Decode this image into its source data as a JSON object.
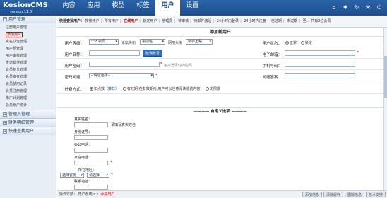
{
  "app": {
    "name": "KesionCMS",
    "version": "version 11.0"
  },
  "mainnav": [
    "内容",
    "应用",
    "模型",
    "标签",
    "用户",
    "设置"
  ],
  "mainnav_active": 4,
  "top_icons": [
    "home-icon",
    "star-icon",
    "refresh-icon",
    "wrench-icon",
    "power-icon"
  ],
  "sidebar": {
    "head": "用户管理",
    "items": [
      "注册用户管理",
      "添加用户",
      "实名认证管理",
      "用户组管理",
      "用户审核管理",
      "发送邮件管理",
      "会员积分管理",
      "会员资金管理",
      "会员使用记录",
      "会员注册管理",
      "推广计划管理",
      "会员账户统计"
    ],
    "active_index": 1,
    "groups": [
      "管理员管理",
      "财务明细管理",
      "快速查找用户"
    ]
  },
  "subnav": {
    "lead": "快速查找用户：",
    "items": [
      "搜索用户",
      "所有用户",
      "在线用户",
      "锁定用户",
      "管理员",
      "待审核",
      "待邮件激活",
      "24小时内登录",
      "24小时内注册",
      "已过期",
      "未过期",
      "更…"
    ],
    "active_index": 2,
    "right": "共有2位会员"
  },
  "form": {
    "title": "添加新用户",
    "group_label": "用户等级：",
    "group_value": "个人会员",
    "title_label": "论坛头衔",
    "title_value": "学前班",
    "level_label": "网吧头衔",
    "level_value": "新手上路",
    "status_label": "用户状态：",
    "status_normal": "正常",
    "status_locked": "锁定",
    "username_label": "用户名称：",
    "check_btn": "检测账号",
    "email_label": "电子邮箱：",
    "password_label": "用户密码：",
    "password_hint": "用户登录时的密码",
    "mobile_label": "手机号码：",
    "question_label": "密码问题：",
    "question_value": "--请您选择--",
    "answer_label": "问题答案：",
    "billing_label": "计费方式：",
    "billing_opt1": "扣点数（",
    "billing_opt1_link": "推荐",
    "billing_opt1_end": "）",
    "billing_opt2": "有效期(在有效期内,用户可以任意阅读收费内容)",
    "billing_opt3": "无限期"
  },
  "custom": {
    "title": "自定义选项",
    "fields": [
      "真实姓名：",
      "身份证号：",
      "办公电话：",
      "家庭电话：",
      "所在地区：",
      "联系地址："
    ],
    "realname_hint": "请填写真实姓名",
    "region_province": "选择省份",
    "region_city": "请选择"
  },
  "footer": {
    "label": "操作导航：",
    "path": "用户系统",
    "arrow": ">>",
    "current": "添加用户",
    "buttons": [
      "添加信息",
      "清除缓存",
      "删除信息",
      "技术支持"
    ]
  }
}
